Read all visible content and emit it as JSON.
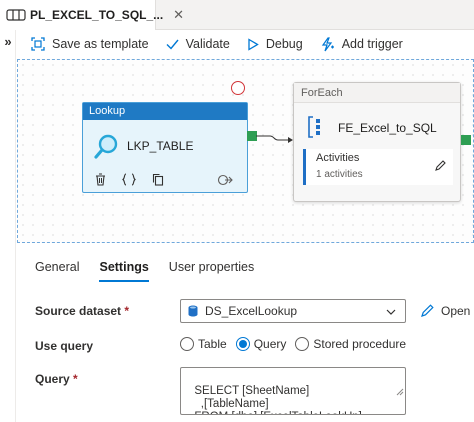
{
  "tab": {
    "title": "PL_EXCEL_TO_SQL_...",
    "close": "✕"
  },
  "sidebar": {
    "expand": "»"
  },
  "toolbar": {
    "save_template": "Save as template",
    "validate": "Validate",
    "debug": "Debug",
    "add_trigger": "Add trigger"
  },
  "canvas": {
    "lookup": {
      "type": "Lookup",
      "name": "LKP_TABLE"
    },
    "foreach": {
      "type": "ForEach",
      "name": "FE_Excel_to_SQL",
      "activities_label": "Activities",
      "activities_count": "1 activities"
    }
  },
  "panel": {
    "tabs": [
      "General",
      "Settings",
      "User properties"
    ],
    "active_tab": "Settings"
  },
  "settings": {
    "source_dataset_label": "Source dataset",
    "required_mark": "*",
    "source_dataset_value": "DS_ExcelLookup",
    "open_label": "Open",
    "use_query_label": "Use query",
    "use_query_options": [
      "Table",
      "Query",
      "Stored procedure"
    ],
    "use_query_selected": "Query",
    "query_label": "Query",
    "query_text": "SELECT [SheetName]\n    ,[TableName]\n  FROM [dbo].[ExcelTableLookUp]"
  },
  "colors": {
    "accent": "#0078d4",
    "activity_header": "#1f7ac4",
    "success": "#2e9e53",
    "error": "#d13438"
  }
}
